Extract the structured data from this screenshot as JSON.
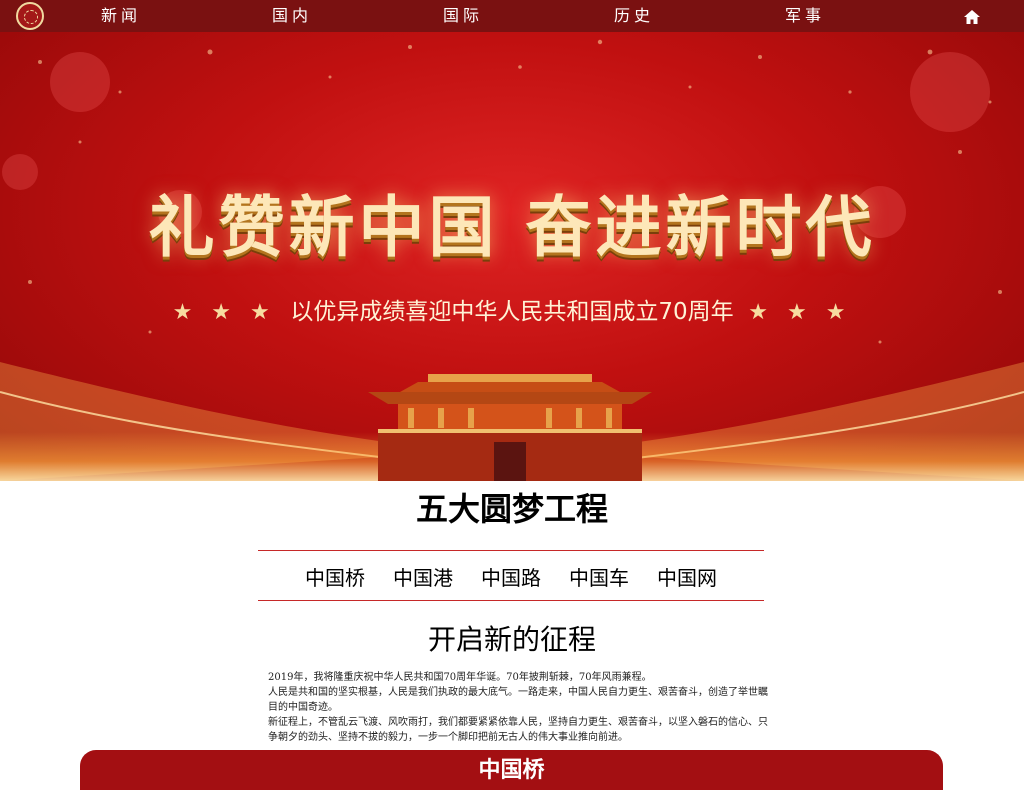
{
  "nav": {
    "items": [
      {
        "label": "新闻"
      },
      {
        "label": "国内"
      },
      {
        "label": "国际"
      },
      {
        "label": "历史"
      },
      {
        "label": "军事"
      }
    ],
    "home_icon": "home-icon"
  },
  "banner": {
    "title": "礼赞新中国  奋进新时代",
    "stars_left": "★ ★ ★",
    "subtitle": "以优异成绩喜迎中华人民共和国成立70周年",
    "stars_right": "★ ★ ★"
  },
  "section": {
    "title": "五大圆梦工程",
    "tabs": [
      {
        "label": "中国桥"
      },
      {
        "label": "中国港"
      },
      {
        "label": "中国路"
      },
      {
        "label": "中国车"
      },
      {
        "label": "中国网"
      }
    ],
    "subtitle": "开启新的征程"
  },
  "article": {
    "paragraphs": [
      "2019年，我将隆重庆祝中华人民共和国70周年华诞。70年披荆斩棘，70年风雨兼程。",
      "人民是共和国的坚实根基，人民是我们执政的最大底气。一路走来，中国人民自力更生、艰苦奋斗，创造了举世瞩目的中国奇迹。",
      "新征程上，不管乱云飞渡、风吹雨打，我们都要紧紧依靠人民，坚持自力更生、艰苦奋斗，以坚入磐石的信心、只争朝夕的劲头、坚持不拔的毅力，一步一个脚印把前无古人的伟大事业推向前进。"
    ]
  },
  "bottom_card": {
    "title": "中国桥"
  },
  "colors": {
    "nav_bg": "#7a1111",
    "banner_red": "#c01010",
    "accent_gold": "#fde7b8",
    "rule_red": "#c62828",
    "card_red": "#a30f12"
  }
}
